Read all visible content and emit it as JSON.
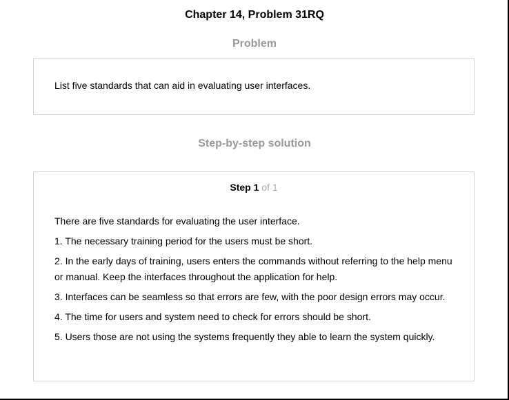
{
  "header": {
    "chapter_title": "Chapter 14, Problem 31RQ"
  },
  "problem": {
    "heading": "Problem",
    "text": "List five standards that can aid in evaluating user interfaces."
  },
  "solution": {
    "heading": "Step-by-step solution",
    "step": {
      "label": "Step 1",
      "count": "of 1"
    },
    "paragraphs": [
      "There are five standards for evaluating the user interface.",
      "1. The necessary training period for the users must be short.",
      "2. In the early days of training, users enters the commands without referring to the help menu or manual. Keep the interfaces throughout the application for help.",
      "3. Interfaces can be seamless so that errors are few, with the poor design errors may occur.",
      "4. The time for users and system need to check for errors should be short.",
      "5. Users those are not using the systems frequently they able to learn the system quickly."
    ]
  }
}
